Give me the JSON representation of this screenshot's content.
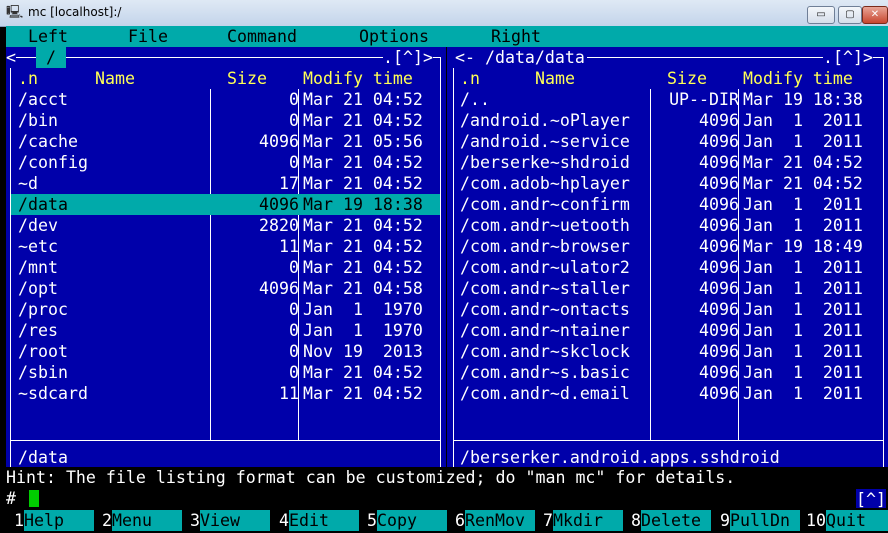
{
  "window": {
    "title": "mc [localhost]:/",
    "icon": "putty-icon",
    "minimize": "▭",
    "maximize": "▢",
    "close": "✕"
  },
  "menu": [
    "Left",
    "File",
    "Command",
    "Options",
    "Right"
  ],
  "left_panel": {
    "path": "/",
    "hotkeys": ".[^]>",
    "headers": {
      "n": ".n",
      "name": "Name",
      "size": "Size",
      "modify": "Modify time"
    },
    "rows": [
      {
        "name": "/acct",
        "size": "0",
        "date": "Mar 21 04:52"
      },
      {
        "name": "/bin",
        "size": "0",
        "date": "Mar 21 04:52"
      },
      {
        "name": "/cache",
        "size": "4096",
        "date": "Mar 21 05:56"
      },
      {
        "name": "/config",
        "size": "0",
        "date": "Mar 21 04:52"
      },
      {
        "name": "~d",
        "size": "17",
        "date": "Mar 21 04:52"
      },
      {
        "name": "/data",
        "size": "4096",
        "date": "Mar 19 18:38",
        "selected": true
      },
      {
        "name": "/dev",
        "size": "2820",
        "date": "Mar 21 04:52"
      },
      {
        "name": "~etc",
        "size": "11",
        "date": "Mar 21 04:52"
      },
      {
        "name": "/mnt",
        "size": "0",
        "date": "Mar 21 04:52"
      },
      {
        "name": "/opt",
        "size": "4096",
        "date": "Mar 21 04:58"
      },
      {
        "name": "/proc",
        "size": "0",
        "date": "Jan  1  1970"
      },
      {
        "name": "/res",
        "size": "0",
        "date": "Jan  1  1970"
      },
      {
        "name": "/root",
        "size": "0",
        "date": "Nov 19  2013"
      },
      {
        "name": "/sbin",
        "size": "0",
        "date": "Mar 21 04:52"
      },
      {
        "name": "~sdcard",
        "size": "11",
        "date": "Mar 21 04:52"
      }
    ],
    "status": "/data"
  },
  "right_panel": {
    "path": "<- /data/data",
    "hotkeys": ".[^]>",
    "headers": {
      "n": ".n",
      "name": "Name",
      "size": "Size",
      "modify": "Modify time"
    },
    "rows": [
      {
        "name": "/..",
        "size": "UP--DIR",
        "date": "Mar 19 18:38"
      },
      {
        "name": "/android.~oPlayer",
        "size": "4096",
        "date": "Jan  1  2011"
      },
      {
        "name": "/android.~service",
        "size": "4096",
        "date": "Jan  1  2011"
      },
      {
        "name": "/berserke~shdroid",
        "size": "4096",
        "date": "Mar 21 04:52"
      },
      {
        "name": "/com.adob~hplayer",
        "size": "4096",
        "date": "Mar 21 04:52"
      },
      {
        "name": "/com.andr~confirm",
        "size": "4096",
        "date": "Jan  1  2011"
      },
      {
        "name": "/com.andr~uetooth",
        "size": "4096",
        "date": "Jan  1  2011"
      },
      {
        "name": "/com.andr~browser",
        "size": "4096",
        "date": "Mar 19 18:49"
      },
      {
        "name": "/com.andr~ulator2",
        "size": "4096",
        "date": "Jan  1  2011"
      },
      {
        "name": "/com.andr~staller",
        "size": "4096",
        "date": "Jan  1  2011"
      },
      {
        "name": "/com.andr~ontacts",
        "size": "4096",
        "date": "Jan  1  2011"
      },
      {
        "name": "/com.andr~ntainer",
        "size": "4096",
        "date": "Jan  1  2011"
      },
      {
        "name": "/com.andr~skclock",
        "size": "4096",
        "date": "Jan  1  2011"
      },
      {
        "name": "/com.andr~s.basic",
        "size": "4096",
        "date": "Jan  1  2011"
      },
      {
        "name": "/com.andr~d.email",
        "size": "4096",
        "date": "Jan  1  2011"
      }
    ],
    "status": "/berserker.android.apps.sshdroid"
  },
  "hint": "Hint: The file listing format can be customized; do \"man mc\" for details.",
  "prompt": "#",
  "cmd_tag": "[^]",
  "fkeys": [
    {
      "num": "1",
      "label": "Help"
    },
    {
      "num": "2",
      "label": "Menu"
    },
    {
      "num": "3",
      "label": "View"
    },
    {
      "num": "4",
      "label": "Edit"
    },
    {
      "num": "5",
      "label": "Copy"
    },
    {
      "num": "6",
      "label": "RenMov"
    },
    {
      "num": "7",
      "label": "Mkdir"
    },
    {
      "num": "8",
      "label": "Delete"
    },
    {
      "num": "9",
      "label": "PullDn"
    },
    {
      "num": "10",
      "label": "Quit"
    }
  ],
  "colors": {
    "panel_bg": "#0000aa",
    "selection": "#00aaaa",
    "header_text": "#ffff55",
    "cursor": "#00cc00"
  }
}
